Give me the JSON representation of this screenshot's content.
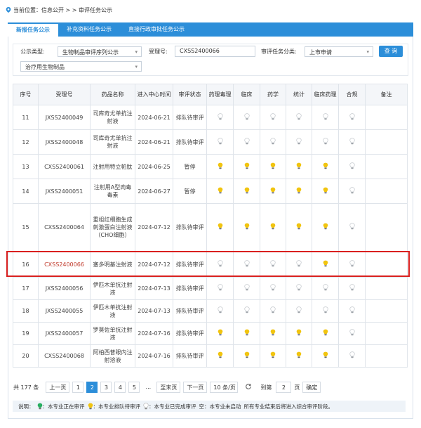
{
  "breadcrumb": {
    "text": "当前位置：信息公开 > > 审评任务公示"
  },
  "tabs": [
    {
      "label": "新报任务公示"
    },
    {
      "label": "补充资料任务公示"
    },
    {
      "label": "直接行政审批任务公示"
    }
  ],
  "filter": {
    "type_label": "公示类型:",
    "type_value": "生物制品审评序列公示",
    "sub_value": "治疗用生物制品",
    "accept_label": "受理号:",
    "accept_value": "CXSS2400066",
    "category_label": "审评任务分类:",
    "category_value": "上市申请",
    "query_label": "查 询"
  },
  "table": {
    "headers": [
      "序号",
      "受理号",
      "药品名称",
      "进入中心时间",
      "审评状态",
      "药理毒理",
      "临床",
      "药学",
      "统计",
      "临床药理",
      "合规",
      "备注"
    ],
    "rows": [
      {
        "no": "11",
        "id": "JXSS2400049",
        "name": "司库奇尤单抗注射液",
        "date": "2024-06-21",
        "status": "排队待审评",
        "lamps": [
          "o",
          "o",
          "o",
          "o",
          "o",
          "o"
        ]
      },
      {
        "no": "12",
        "id": "JXSS2400048",
        "name": "司库奇尤单抗注射液",
        "date": "2024-06-21",
        "status": "排队待审评",
        "lamps": [
          "o",
          "o",
          "o",
          "o",
          "o",
          "o"
        ]
      },
      {
        "no": "13",
        "id": "CXSS2400061",
        "name": "注射用特立帕肽",
        "date": "2024-06-25",
        "status": "暂停",
        "lamps": [
          "y",
          "y",
          "y",
          "y",
          "y",
          "o"
        ]
      },
      {
        "no": "14",
        "id": "JXSS2400051",
        "name": "注射用A型肉毒毒素",
        "date": "2024-06-27",
        "status": "暂停",
        "lamps": [
          "y",
          "y",
          "y",
          "y",
          "y",
          "o"
        ]
      },
      {
        "no": "15",
        "id": "CXSS2400064",
        "name": "重组红细胞生成刺激蛋白注射液（CHO细胞）",
        "date": "2024-07-12",
        "status": "排队待审评",
        "lamps": [
          "y",
          "y",
          "y",
          "y",
          "y",
          "o"
        ]
      },
      {
        "no": "16",
        "id": "CXSS2400066",
        "name": "塞多明基注射液",
        "date": "2024-07-12",
        "status": "排队待审评",
        "lamps": [
          "o",
          "o",
          "o",
          "o",
          "y",
          "o"
        ]
      },
      {
        "no": "17",
        "id": "JXSS2400056",
        "name": "伊匹木单抗注射液",
        "date": "2024-07-13",
        "status": "排队待审评",
        "lamps": [
          "o",
          "o",
          "o",
          "o",
          "o",
          "o"
        ]
      },
      {
        "no": "18",
        "id": "JXSS2400055",
        "name": "伊匹木单抗注射液",
        "date": "2024-07-13",
        "status": "排队待审评",
        "lamps": [
          "o",
          "o",
          "o",
          "o",
          "o",
          "o"
        ]
      },
      {
        "no": "19",
        "id": "JXSS2400057",
        "name": "罗莫佐单抗注射液",
        "date": "2024-07-16",
        "status": "排队待审评",
        "lamps": [
          "y",
          "y",
          "y",
          "y",
          "y",
          "o"
        ]
      },
      {
        "no": "20",
        "id": "CXSS2400068",
        "name": "阿柏西普眼内注射溶液",
        "date": "2024-07-16",
        "status": "排队待审评",
        "lamps": [
          "y",
          "y",
          "y",
          "y",
          "y",
          "o"
        ]
      }
    ]
  },
  "pager": {
    "total": "共 177 条",
    "prev": "上一页",
    "pages": [
      "1",
      "2",
      "3",
      "4",
      "5",
      "..."
    ],
    "current": "2",
    "last": "至末页",
    "next": "下一页",
    "per_page": "10 条/页",
    "goto_label": "到第",
    "goto_value": "2",
    "page_unit": "页",
    "confirm": "确定"
  },
  "legend": {
    "intro": "说明：",
    "green": "：本专业正在审评",
    "yellow": "：本专业排队待审评",
    "grey": "：本专业已完成审评",
    "empty": "空：本专业未启动",
    "note": "所有专业结束后将进入综合审评阶段。"
  },
  "colors": {
    "accent": "#2c8ed9",
    "highlight": "#d9201f",
    "highlight_text": "#c0392b",
    "lamp_yellow": "#f1c40f",
    "lamp_off": "#d5d8dc",
    "lamp_green": "#27ae60"
  }
}
